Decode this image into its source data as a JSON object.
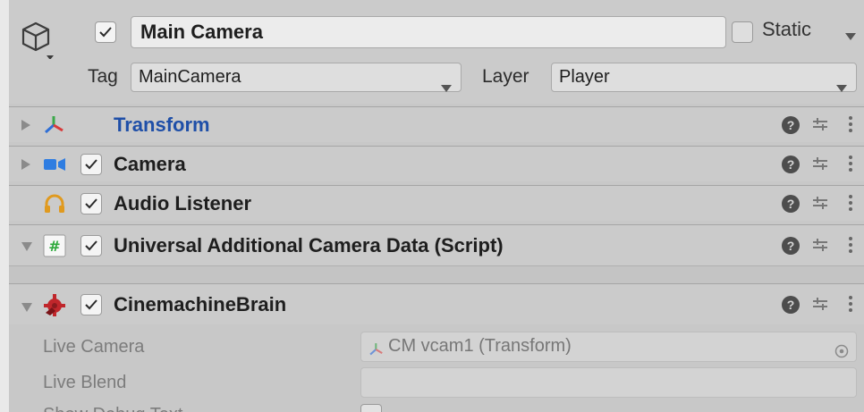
{
  "header": {
    "active": true,
    "name": "Main Camera",
    "static_label": "Static",
    "static_checked": false,
    "tag_label": "Tag",
    "tag_value": "MainCamera",
    "layer_label": "Layer",
    "layer_value": "Player"
  },
  "components": [
    {
      "title": "Transform",
      "icon": "transform-icon",
      "expanded": false,
      "has_checkbox": false,
      "title_color": "#1f4fa8"
    },
    {
      "title": "Camera",
      "icon": "camera-icon",
      "expanded": false,
      "has_checkbox": true,
      "checked": true
    },
    {
      "title": "Audio Listener",
      "icon": "headphones-icon",
      "expanded": false,
      "has_checkbox": true,
      "checked": true
    },
    {
      "title": "Universal Additional Camera Data (Script)",
      "icon": "script-icon",
      "expanded": true,
      "has_checkbox": true,
      "checked": true
    },
    {
      "title": "CinemachineBrain",
      "icon": "cinemachine-icon",
      "expanded": true,
      "has_checkbox": true,
      "checked": true
    }
  ],
  "cinemachine_brain": {
    "live_camera_label": "Live Camera",
    "live_camera_value": "CM vcam1 (Transform)",
    "live_blend_label": "Live Blend",
    "live_blend_value": "",
    "show_debug_label": "Show Debug Text"
  },
  "colors": {
    "transform_title": "#1f4fa8",
    "camera_icon": "#2f7de1",
    "headphones_icon": "#e09a1f",
    "script_icon": "#2eaa3c",
    "cinemachine_icon": "#c0262b"
  }
}
